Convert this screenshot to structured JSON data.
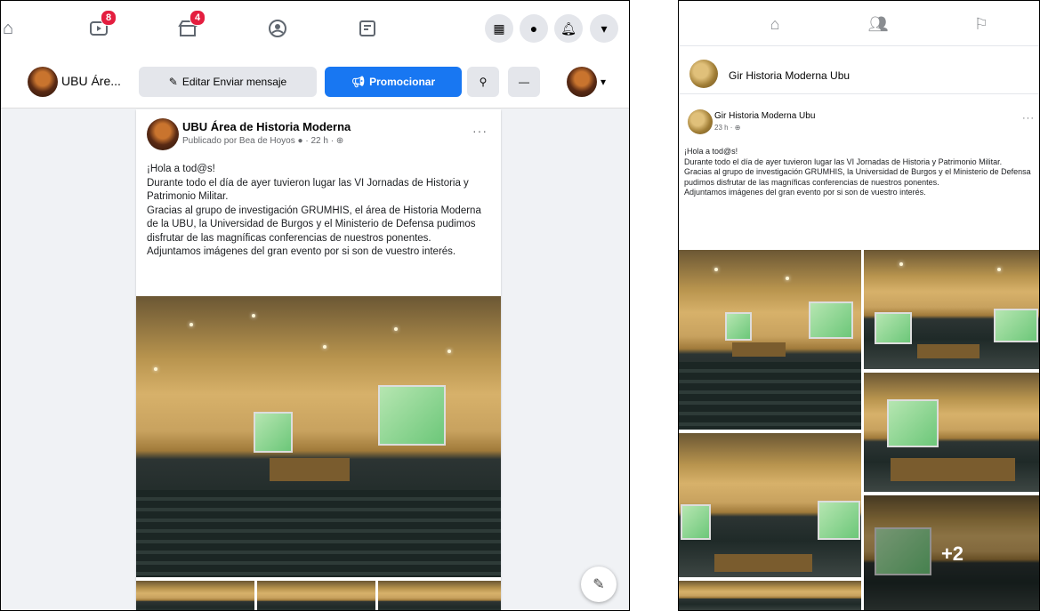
{
  "left": {
    "nav": {
      "watch_badge": "8",
      "marketplace_badge": "4"
    },
    "page_header": {
      "name": "UBU Áre...",
      "edit_label": "Editar Enviar mensaje",
      "promote_label": "Promocionar",
      "search_icon": "search-icon",
      "more_icon": "more-icon"
    },
    "post": {
      "author": "UBU Área de Historia Moderna",
      "published_by": "Publicado por Bea de Hoyos",
      "time": "22 h",
      "lines": [
        "¡Hola a tod@s!",
        "Durante todo el día de ayer tuvieron lugar las VI Jornadas de Historia y Patrimonio Militar.",
        "Gracias al grupo de investigación GRUMHIS, el área de Historia Moderna de la UBU, la Universidad de Burgos y el Ministerio de Defensa pudimos disfrutar de las magníficas conferencias de nuestros ponentes.",
        "Adjuntamos imágenes del gran evento por si son de vuestro interés."
      ]
    }
  },
  "right": {
    "group_name": "Gir Historia Moderna Ubu",
    "post": {
      "author": "Gir Historia Moderna Ubu",
      "time": "23 h",
      "lines": [
        "¡Hola a tod@s!",
        "Durante todo el día de ayer tuvieron lugar las VI Jornadas de Historia y Patrimonio Militar.",
        "Gracias al grupo de investigación GRUMHIS, la Universidad de Burgos y el Ministerio de Defensa pudimos disfrutar de las magníficas conferencias de nuestros ponentes.",
        "Adjuntamos imágenes del gran evento por si son de vuestro interés."
      ],
      "more_photos": "+2"
    }
  },
  "colors": {
    "accent": "#1877f2",
    "badge": "#e41e3f"
  }
}
